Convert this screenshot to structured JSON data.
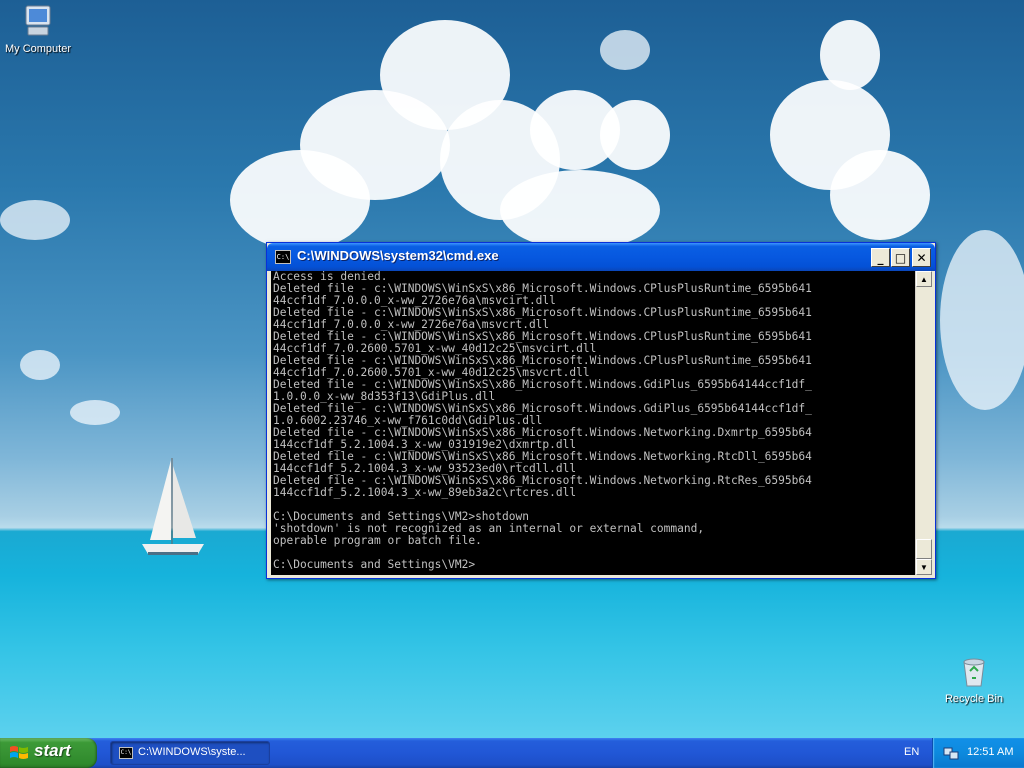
{
  "desktop": {
    "icons": [
      {
        "label": "My Computer",
        "icon": "my-computer-icon"
      },
      {
        "label": "Recycle Bin",
        "icon": "recycle-bin-icon"
      }
    ]
  },
  "cmd_window": {
    "title": "C:\\WINDOWS\\system32\\cmd.exe",
    "icon_text": "C:\\",
    "controls": {
      "minimize": "_",
      "maximize": "□",
      "close": "✕"
    },
    "lines": [
      "Access is denied.",
      "Deleted file - c:\\WINDOWS\\WinSxS\\x86_Microsoft.Windows.CPlusPlusRuntime_6595b641",
      "44ccf1df_7.0.0.0_x-ww_2726e76a\\msvcirt.dll",
      "Deleted file - c:\\WINDOWS\\WinSxS\\x86_Microsoft.Windows.CPlusPlusRuntime_6595b641",
      "44ccf1df_7.0.0.0_x-ww_2726e76a\\msvcrt.dll",
      "Deleted file - c:\\WINDOWS\\WinSxS\\x86_Microsoft.Windows.CPlusPlusRuntime_6595b641",
      "44ccf1df_7.0.2600.5701_x-ww_40d12c25\\msvcirt.dll",
      "Deleted file - c:\\WINDOWS\\WinSxS\\x86_Microsoft.Windows.CPlusPlusRuntime_6595b641",
      "44ccf1df_7.0.2600.5701_x-ww_40d12c25\\msvcrt.dll",
      "Deleted file - c:\\WINDOWS\\WinSxS\\x86_Microsoft.Windows.GdiPlus_6595b64144ccf1df_",
      "1.0.0.0_x-ww_8d353f13\\GdiPlus.dll",
      "Deleted file - c:\\WINDOWS\\WinSxS\\x86_Microsoft.Windows.GdiPlus_6595b64144ccf1df_",
      "1.0.6002.23746_x-ww_f761c0dd\\GdiPlus.dll",
      "Deleted file - c:\\WINDOWS\\WinSxS\\x86_Microsoft.Windows.Networking.Dxmrtp_6595b64",
      "144ccf1df_5.2.1004.3_x-ww_031919e2\\dxmrtp.dll",
      "Deleted file - c:\\WINDOWS\\WinSxS\\x86_Microsoft.Windows.Networking.RtcDll_6595b64",
      "144ccf1df_5.2.1004.3_x-ww_93523ed0\\rtcdll.dll",
      "Deleted file - c:\\WINDOWS\\WinSxS\\x86_Microsoft.Windows.Networking.RtcRes_6595b64",
      "144ccf1df_5.2.1004.3_x-ww_89eb3a2c\\rtcres.dll",
      "",
      "C:\\Documents and Settings\\VM2>shotdown",
      "'shotdown' is not recognized as an internal or external command,",
      "operable program or batch file.",
      "",
      "C:\\Documents and Settings\\VM2>"
    ]
  },
  "taskbar": {
    "start_label": "start",
    "task_label": "C:\\WINDOWS\\syste...",
    "task_icon_text": "C:\\",
    "language": "EN",
    "clock": "12:51 AM"
  },
  "colors": {
    "titlebar": "#0758e0",
    "taskbar": "#245edb",
    "start_button": "#379233",
    "console_bg": "#000000",
    "console_text": "#c0c0c0"
  }
}
